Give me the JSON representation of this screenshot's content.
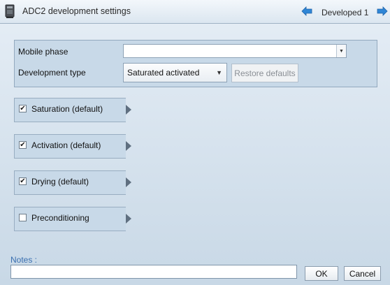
{
  "window": {
    "title": "ADC2 development settings",
    "nav_label": "Developed 1",
    "app_icon": "adc2-device-icon",
    "nav_prev_icon": "arrow-left-icon",
    "nav_next_icon": "arrow-right-icon",
    "accent_color": "#2f86d6"
  },
  "settings": {
    "mobile_phase_label": "Mobile phase",
    "mobile_phase_value": "",
    "development_type_label": "Development type",
    "development_type_value": "Saturated activated",
    "restore_defaults_label": "Restore defaults"
  },
  "sections": [
    {
      "label": "Saturation (default)",
      "checked": true
    },
    {
      "label": "Activation (default)",
      "checked": true
    },
    {
      "label": "Drying (default)",
      "checked": true
    },
    {
      "label": "Preconditioning",
      "checked": false
    }
  ],
  "footer": {
    "notes_label": "Notes :",
    "notes_value": "",
    "ok_label": "OK",
    "cancel_label": "Cancel"
  }
}
